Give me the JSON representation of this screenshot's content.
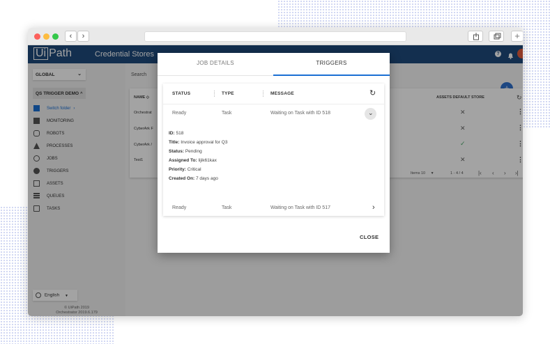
{
  "app": {
    "logo_left": "Ui",
    "logo_right": "Path",
    "title": "Credential Stores"
  },
  "sidebar": {
    "tenant": "GLOBAL",
    "folder": "QS TRIGGER DEMO",
    "switch_folder": "Switch folder",
    "items": [
      {
        "label": "MONITORING",
        "icon": "monitoring-icon"
      },
      {
        "label": "ROBOTS",
        "icon": "robot-icon"
      },
      {
        "label": "PROCESSES",
        "icon": "processes-icon"
      },
      {
        "label": "JOBS",
        "icon": "jobs-icon"
      },
      {
        "label": "TRIGGERS",
        "icon": "triggers-icon"
      },
      {
        "label": "ASSETS",
        "icon": "assets-icon"
      },
      {
        "label": "QUEUES",
        "icon": "queues-icon"
      },
      {
        "label": "TASKS",
        "icon": "tasks-icon"
      }
    ],
    "language": "English",
    "footer_line1": "© UiPath 2019",
    "footer_line2": "Orchestrator 2019.6.179"
  },
  "main": {
    "search_label": "Search",
    "table": {
      "col_name": "NAME",
      "col_default": "ASSETS DEFAULT STORE",
      "rows": [
        {
          "name": "Orchestrat",
          "default_store": "x"
        },
        {
          "name": "CyberArk F",
          "default_store": "x"
        },
        {
          "name": "CyberArk /",
          "default_store": "check"
        },
        {
          "name": "Test1",
          "default_store": "x"
        }
      ]
    },
    "pager": {
      "items_label": "Items",
      "items_value": "10",
      "range": "1 - 4 / 4"
    }
  },
  "modal": {
    "tab_job_details": "JOB DETAILS",
    "tab_triggers": "TRIGGERS",
    "columns": {
      "status": "STATUS",
      "type": "TYPE",
      "message": "MESSAGE"
    },
    "rows": [
      {
        "status": "Ready",
        "type": "Task",
        "message": "Waiting on Task with ID 518"
      },
      {
        "status": "Ready",
        "type": "Task",
        "message": "Waiting on Task with ID 517"
      }
    ],
    "detail": {
      "id_label": "ID:",
      "id_value": "518",
      "title_label": "Title:",
      "title_value": "Invoice approval for Q3",
      "status_label": "Status:",
      "status_value": "Pending",
      "assigned_label": "Assigned To:",
      "assigned_value": "lijik61kax",
      "priority_label": "Priority:",
      "priority_value": "Critical",
      "created_label": "Created On:",
      "created_value": "7 days ago"
    },
    "close_label": "CLOSE"
  },
  "colors": {
    "appbar": "#1e4a7c",
    "tab_accent": "#1a6fd4",
    "fab": "#2e6fcb"
  }
}
